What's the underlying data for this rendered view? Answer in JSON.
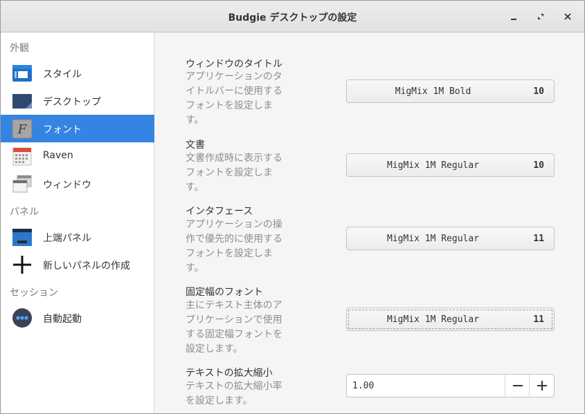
{
  "window": {
    "title": "Budgie デスクトップの設定"
  },
  "sidebar": {
    "sections": [
      {
        "label": "外観"
      },
      {
        "label": "パネル"
      },
      {
        "label": "セッション"
      }
    ],
    "items": [
      {
        "label": "スタイル",
        "icon": "style-icon"
      },
      {
        "label": "デスクトップ",
        "icon": "desktop-icon"
      },
      {
        "label": "フォント",
        "icon": "font-icon",
        "active": true
      },
      {
        "label": "Raven",
        "icon": "calendar-icon"
      },
      {
        "label": "ウィンドウ",
        "icon": "windows-icon"
      },
      {
        "label": "上端パネル",
        "icon": "panel-icon"
      },
      {
        "label": "新しいパネルの作成",
        "icon": "plus-icon"
      },
      {
        "label": "自動起動",
        "icon": "autostart-icon"
      }
    ]
  },
  "fonts": [
    {
      "title": "ウィンドウのタイトル",
      "desc_lines": [
        "アプリケーションのタ",
        "イトルバーに使用する",
        "フォントを設定しま",
        "す。"
      ],
      "font": "MigMix 1M Bold",
      "size": "10"
    },
    {
      "title": "文書",
      "desc_lines": [
        "文書作成時に表示する",
        "フォントを設定しま",
        "す。"
      ],
      "font": "MigMix 1M Regular",
      "size": "10"
    },
    {
      "title": "インタフェース",
      "desc_lines": [
        "アプリケーションの操",
        "作で優先的に使用する",
        "フォントを設定しま",
        "す。"
      ],
      "font": "MigMix 1M Regular",
      "size": "11"
    },
    {
      "title": "固定幅のフォント",
      "desc_lines": [
        "主にテキスト主体のア",
        "プリケーションで使用",
        "する固定幅フォントを",
        "設定します。"
      ],
      "font": "MigMix 1M Regular",
      "size": "11"
    }
  ],
  "scaling": {
    "title": "テキストの拡大縮小",
    "desc_lines": [
      "テキストの拡大縮小率",
      "を設定します。"
    ],
    "value": "1.00"
  },
  "colors": {
    "accent": "#3584e4"
  }
}
